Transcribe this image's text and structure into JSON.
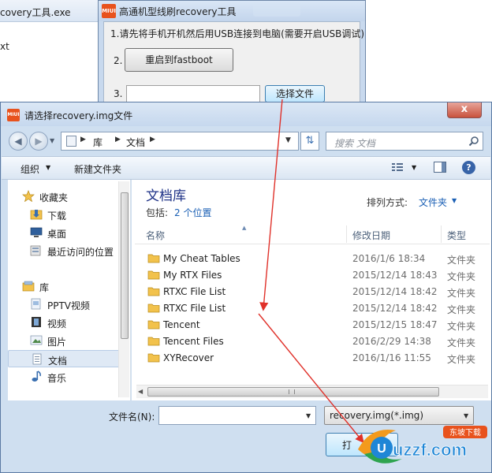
{
  "background_window": {
    "title": "covery工具.exe",
    "text": "xt"
  },
  "tool": {
    "logo_text": "MIUI",
    "title": "高通机型线刷recovery工具",
    "step1": "1.请先将手机开机然后用USB连接到电脑(需要开启USB调试)",
    "step2_num": "2.",
    "reboot_button": "重启到fastboot",
    "step3_num": "3.",
    "path_value": "",
    "choose_button": "选择文件"
  },
  "dialog": {
    "logo_text": "MIUI",
    "title": "请选择recovery.img文件",
    "close_symbol": "x",
    "address": {
      "parts": [
        "库",
        "文档"
      ]
    },
    "search_placeholder": "搜索 文档",
    "toolbar": {
      "organize": "组织",
      "new_folder": "新建文件夹",
      "help": "?"
    },
    "nav": [
      {
        "label": "收藏夹",
        "icon": "star-icon",
        "group": true
      },
      {
        "label": "下载",
        "icon": "download-folder-icon",
        "group": false
      },
      {
        "label": "桌面",
        "icon": "desktop-icon",
        "group": false
      },
      {
        "label": "最近访问的位置",
        "icon": "recent-places-icon",
        "group": false
      },
      {
        "label": "库",
        "icon": "library-icon",
        "group": true
      },
      {
        "label": "PPTV视频",
        "icon": "pptv-library-icon",
        "group": false
      },
      {
        "label": "视频",
        "icon": "video-library-icon",
        "group": false
      },
      {
        "label": "图片",
        "icon": "pictures-library-icon",
        "group": false
      },
      {
        "label": "文档",
        "icon": "documents-library-icon",
        "group": false,
        "selected": true
      },
      {
        "label": "音乐",
        "icon": "music-library-icon",
        "group": false
      }
    ],
    "library": {
      "title": "文档库",
      "includes_label": "包括:",
      "includes_link": "2 个位置",
      "arrange_label": "排列方式:",
      "arrange_value": "文件夹"
    },
    "columns": {
      "name": "名称",
      "date": "修改日期",
      "type": "类型"
    },
    "files": [
      {
        "name": "My Cheat Tables",
        "date": "2016/1/6 18:34",
        "type": "文件夹"
      },
      {
        "name": "My RTX Files",
        "date": "2015/12/14 18:43",
        "type": "文件夹"
      },
      {
        "name": "RTXC File List",
        "date": "2015/12/14 18:42",
        "type": "文件夹"
      },
      {
        "name": "RTXC File List",
        "date": "2015/12/14 18:42",
        "type": "文件夹"
      },
      {
        "name": "Tencent",
        "date": "2015/12/15 18:47",
        "type": "文件夹"
      },
      {
        "name": "Tencent Files",
        "date": "2016/2/29 14:38",
        "type": "文件夹"
      },
      {
        "name": "XYRecover",
        "date": "2016/1/16 11:55",
        "type": "文件夹"
      }
    ],
    "filename_label": "文件名(N):",
    "filename_value": "",
    "filter_value": "recovery.img(*.img)",
    "open_button": "打"
  },
  "watermark": {
    "brand": "uzzf.com",
    "tag": "东坡下载"
  },
  "colors": {
    "arrow": "#e0312a",
    "link": "#1a5fb4",
    "library_title": "#1e3287",
    "folder": "#f2c24c"
  }
}
